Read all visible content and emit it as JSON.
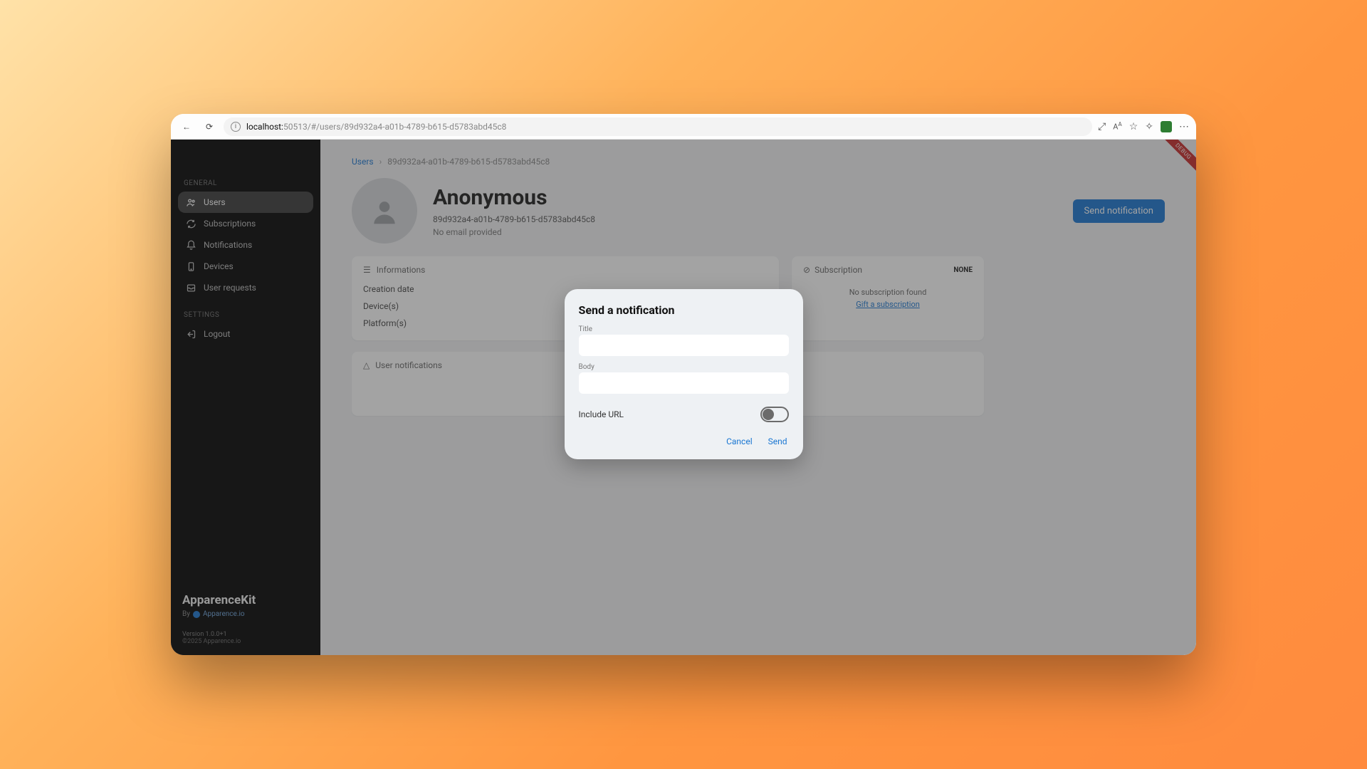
{
  "browser": {
    "host": "localhost:",
    "port_path": "50513/#/users/89d932a4-a01b-4789-b615-d5783abd45c8"
  },
  "sidebar": {
    "sections": {
      "general": "GENERAL",
      "settings": "SETTINGS"
    },
    "items": [
      {
        "label": "Users"
      },
      {
        "label": "Subscriptions"
      },
      {
        "label": "Notifications"
      },
      {
        "label": "Devices"
      },
      {
        "label": "User requests"
      }
    ],
    "logout": "Logout",
    "brand": "ApparenceKit",
    "byline_prefix": "By",
    "byline_name": "Apparence.io",
    "version": "Version 1.0.0+1",
    "copyright": "©2025 Apparence.io"
  },
  "breadcrumb": {
    "root": "Users",
    "current": "89d932a4-a01b-4789-b615-d5783abd45c8"
  },
  "profile": {
    "name": "Anonymous",
    "uid": "89d932a4-a01b-4789-b615-d5783abd45c8",
    "email_status": "No email provided",
    "send_button": "Send notification"
  },
  "cards": {
    "info": {
      "title": "Informations",
      "rows": [
        "Creation date",
        "Device(s)",
        "Platform(s)"
      ]
    },
    "subscription": {
      "title": "Subscription",
      "badge": "NONE",
      "empty_msg": "No subscription found",
      "gift_link": "Gift a subscription"
    },
    "notifications": {
      "title": "User notifications"
    }
  },
  "modal": {
    "title": "Send a notification",
    "title_label": "Title",
    "body_label": "Body",
    "toggle_label": "Include URL",
    "cancel": "Cancel",
    "send": "Send"
  },
  "debug_label": "DEBUG"
}
